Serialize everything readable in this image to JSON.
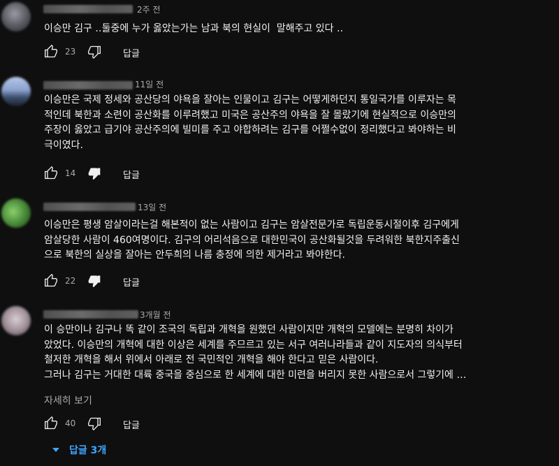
{
  "comments": [
    {
      "time": "2주 전",
      "text": "이승만 김구 ‥둘중에 누가 옳았는가는 남과 북의 현실이  말해주고 있다 ‥",
      "likes": "23",
      "reply_label": "답글"
    },
    {
      "time": "11일 전",
      "text": "이승만은 국제 정세와 공산당의 야욕을 잘아는 인물이고 김구는 어떻게하던지 통일국가를 이루자는 목\n적인데 북한과 소련이 공산화를 이루려했고 미국은 공산주의 야욕을 잘 몰랐기에 현실적으로 이승만의\n주장이 옳았고 급기야 공산주의에 빌미를 주고 야합하려는 김구를 어쩔수없이 정리했다고 봐야하는 비\n극이였다.",
      "likes": "14",
      "reply_label": "답글"
    },
    {
      "time": "13일 전",
      "text": "이승만은 평생 암살이라는걸 해본적이 없는 사람이고 김구는 암살전문가로 독립운동시절이후 김구에게\n암살당한 사람이 460여명이다. 김구의 어리석음으로 대한민국이 공산화될것을 두려워한 북한지주출신\n으로 북한의 실상을 잘아는 안두희의 나름 충정에 의한 제거라고 봐야한다.",
      "likes": "22",
      "reply_label": "답글"
    },
    {
      "time": "3개월 전",
      "text": "이 승만이나 김구나 똑 같이 조국의 독립과 개혁을 원했던 사람이지만 개혁의 모델에는 분명히 차이가\n았었다. 이승만의 개혁에 대한 이상은 세계를 주므르고 있는 서구 여러나라들과 같이 지도자의 의식부터\n철저한 개혁을 해서 위에서 아래로 전 국민적인 개혁을 해야 한다고 믿은 사람이다.\n그러나 김구는 거대한 대륙 중국을 중심으로 한 세계에 대한 미련을 버리지 못한 사람으로서 그렇기에 …",
      "read_more": "자세히 보기",
      "likes": "40",
      "reply_label": "답글",
      "replies_label": "답글 3개"
    }
  ],
  "icons": {
    "like": "thumb-up-icon",
    "dislike": "thumb-down-icon",
    "expand": "chevron-down-icon"
  },
  "colors": {
    "background": "#0f0f0f",
    "text": "#f1f1f1",
    "secondary": "#aaaaaa",
    "link": "#3ea6ff"
  }
}
